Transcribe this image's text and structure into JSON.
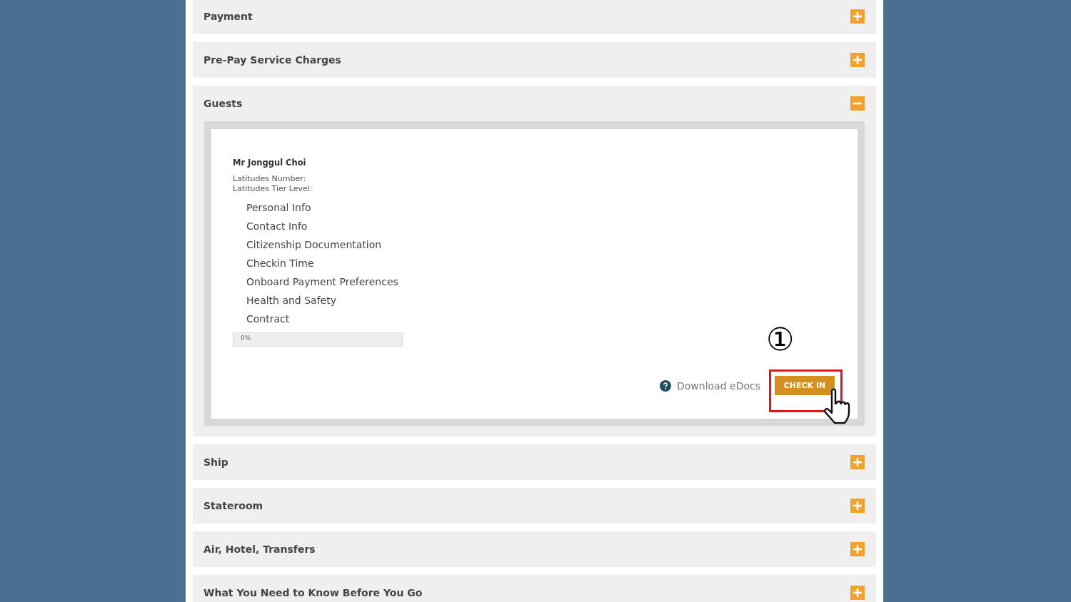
{
  "sections": [
    {
      "title": "Payment",
      "expanded": false
    },
    {
      "title": "Pre-Pay Service Charges",
      "expanded": false
    },
    {
      "title": "Guests",
      "expanded": true,
      "guest": {
        "name": "Mr Jonggul Choi",
        "details": [
          "Latitudes Number:",
          "Latitudes Tier Level:"
        ],
        "steps": [
          "Personal Info",
          "Contact Info",
          "Citizenship Documentation",
          "Checkin Time",
          "Onboard Payment Preferences",
          "Health and Safety",
          "Contract"
        ],
        "progress": {
          "level": 0,
          "label": "0%"
        },
        "download_link": "Download eDocs",
        "check_in_button": "CHECK IN",
        "annotation": {
          "step": "①"
        }
      }
    },
    {
      "title": "Ship",
      "expanded": false
    },
    {
      "title": "Stateroom",
      "expanded": false
    },
    {
      "title": "Air, Hotel, Transfers",
      "expanded": false
    },
    {
      "title": "What You Need to Know Before You Go",
      "expanded": false
    }
  ]
}
